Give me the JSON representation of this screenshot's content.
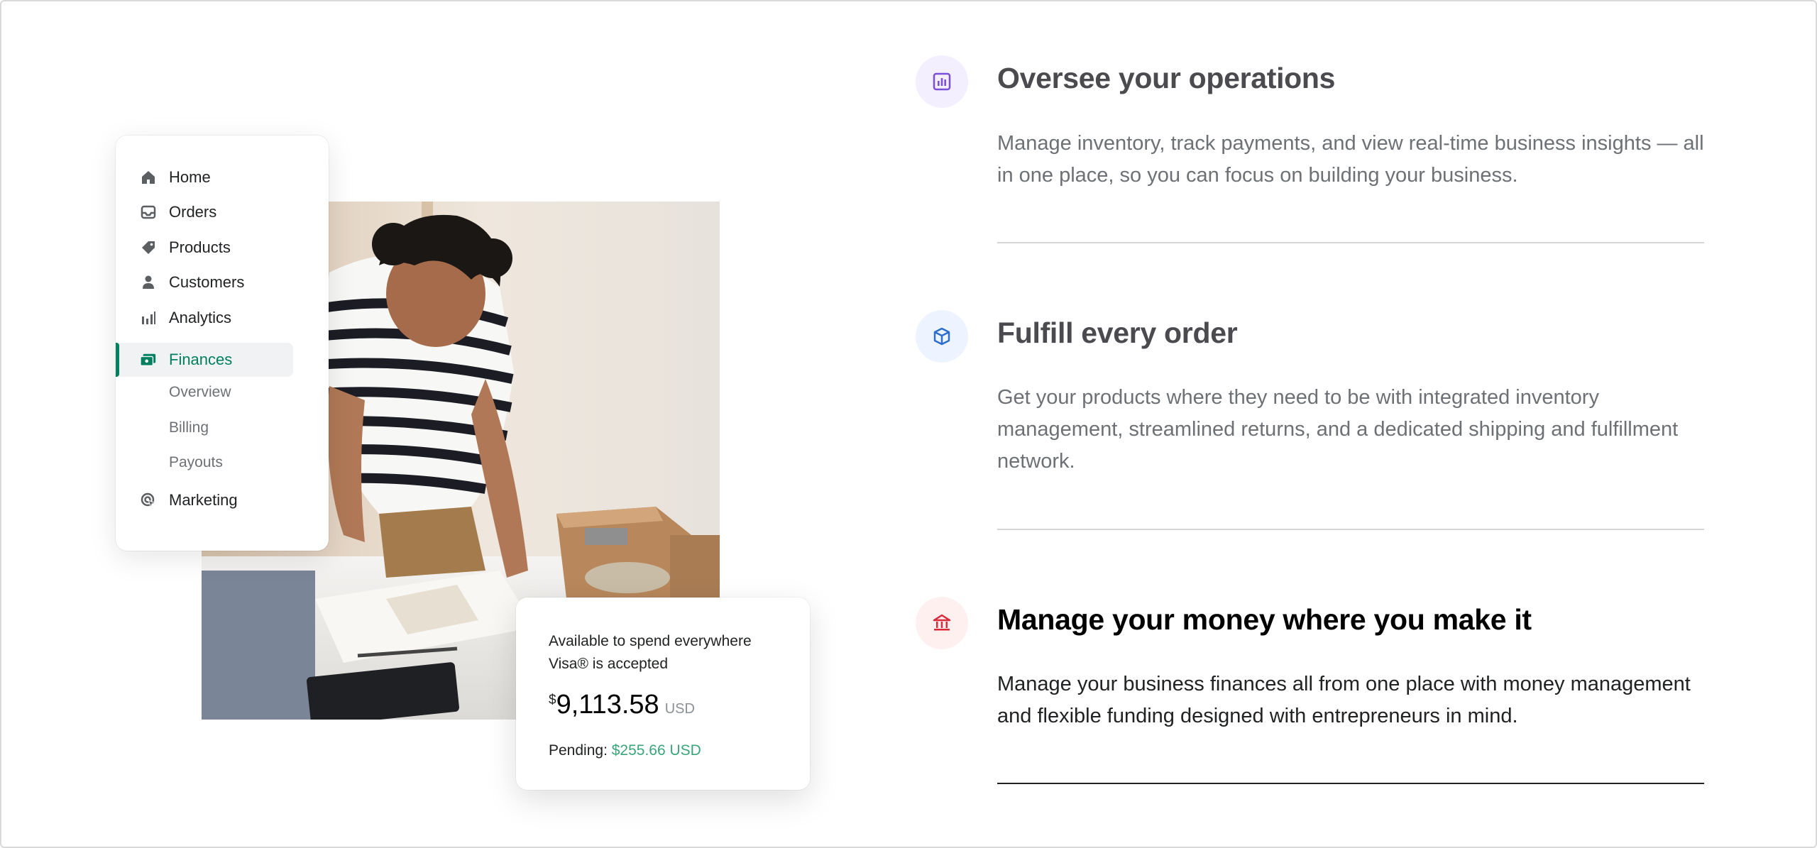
{
  "sidebar": {
    "items": [
      {
        "label": "Home",
        "icon": "home-icon"
      },
      {
        "label": "Orders",
        "icon": "inbox-icon"
      },
      {
        "label": "Products",
        "icon": "tag-icon"
      },
      {
        "label": "Customers",
        "icon": "person-icon"
      },
      {
        "label": "Analytics",
        "icon": "bar-chart-icon"
      },
      {
        "label": "Finances",
        "icon": "finances-icon",
        "active": true
      },
      {
        "label": "Marketing",
        "icon": "target-icon"
      }
    ],
    "finance_subitems": [
      "Overview",
      "Billing",
      "Payouts"
    ]
  },
  "balance_card": {
    "available_text": "Available to spend everywhere Visa® is accepted",
    "currency_symbol": "$",
    "amount": "9,113.58",
    "currency": "USD",
    "pending_label": "Pending:",
    "pending_value": "$255.66 USD"
  },
  "features": [
    {
      "title": "Oversee your operations",
      "description": "Manage inventory, track payments, and view real-time business insights — all in one place, so you can focus on building your business.",
      "icon": "analytics-icon",
      "icon_color": "#7b4fd6",
      "icon_bg": "#f3efff"
    },
    {
      "title": "Fulfill every order",
      "description": "Get your products where they need to be with integrated inventory management, streamlined returns, and a dedicated shipping and fulfillment network.",
      "icon": "package-icon",
      "icon_color": "#2c6ecb",
      "icon_bg": "#eef4ff"
    },
    {
      "title": "Manage your money where you make it",
      "description": "Manage your business finances all from one place with money management and flexible funding designed with entrepreneurs in mind.",
      "icon": "bank-icon",
      "icon_color": "#d82c3c",
      "icon_bg": "#fff0f0",
      "active": true
    }
  ],
  "colors": {
    "accent_green": "#008060",
    "inactive_title": "#4a4a4f",
    "active_title": "#000000"
  }
}
